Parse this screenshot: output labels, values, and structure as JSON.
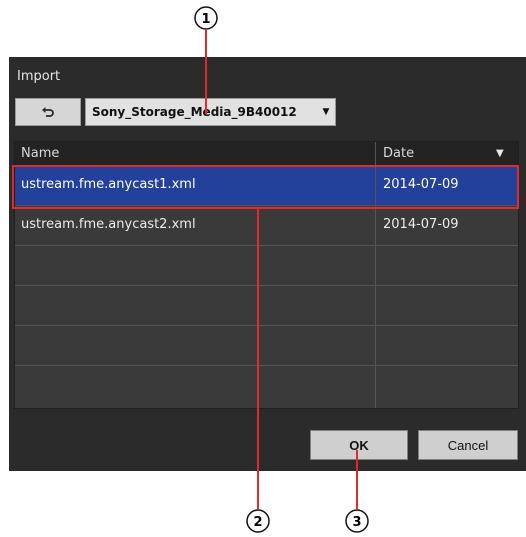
{
  "dialog": {
    "title": "Import",
    "storage_dropdown": {
      "selected": "Sony_Storage_Media_9B40012"
    },
    "table": {
      "headers": {
        "name": "Name",
        "date": "Date"
      },
      "rows": [
        {
          "name": "ustream.fme.anycast1.xml",
          "date": "2014-07-09",
          "selected": true
        },
        {
          "name": "ustream.fme.anycast2.xml",
          "date": "2014-07-09",
          "selected": false
        }
      ]
    },
    "ok_label": "OK",
    "cancel_label": "Cancel"
  },
  "callouts": {
    "one": "1",
    "two": "2",
    "three": "3"
  },
  "colors": {
    "dialog_bg": "#2b2b2b",
    "selection": "#23419a",
    "annotation_red": "#e22a2a"
  },
  "icons": {
    "back": "undo-arrow-icon",
    "dropdown": "triangle-down-icon",
    "sort": "triangle-down-icon"
  }
}
